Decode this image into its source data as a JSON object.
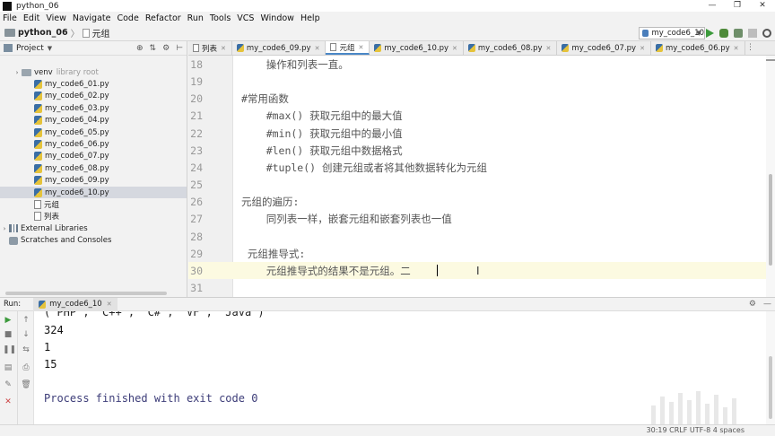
{
  "window": {
    "title": "python_06",
    "controls": [
      "—",
      "❐",
      "✕"
    ]
  },
  "menu": [
    "File",
    "Edit",
    "View",
    "Navigate",
    "Code",
    "Refactor",
    "Run",
    "Tools",
    "VCS",
    "Window",
    "Help"
  ],
  "nav": {
    "project": "python_06",
    "separator": "〉",
    "crumb": "元组",
    "run_config": "my_code6_10"
  },
  "project_panel": {
    "title": "Project",
    "tree": [
      {
        "kind": "folder",
        "label": "venv",
        "muted": "library root",
        "indent": 1,
        "arrow": "›"
      },
      {
        "kind": "py",
        "label": "my_code6_01.py",
        "indent": 2
      },
      {
        "kind": "py",
        "label": "my_code6_02.py",
        "indent": 2
      },
      {
        "kind": "py",
        "label": "my_code6_03.py",
        "indent": 2
      },
      {
        "kind": "py",
        "label": "my_code6_04.py",
        "indent": 2
      },
      {
        "kind": "py",
        "label": "my_code6_05.py",
        "indent": 2
      },
      {
        "kind": "py",
        "label": "my_code6_06.py",
        "indent": 2
      },
      {
        "kind": "py",
        "label": "my_code6_07.py",
        "indent": 2
      },
      {
        "kind": "py",
        "label": "my_code6_08.py",
        "indent": 2
      },
      {
        "kind": "py",
        "label": "my_code6_09.py",
        "indent": 2
      },
      {
        "kind": "py",
        "label": "my_code6_10.py",
        "indent": 2,
        "selected": true
      },
      {
        "kind": "txt",
        "label": "元组",
        "indent": 2
      },
      {
        "kind": "txt",
        "label": "列表",
        "indent": 2
      },
      {
        "kind": "lib",
        "label": "External Libraries",
        "indent": 0,
        "arrow": "›"
      },
      {
        "kind": "scratch",
        "label": "Scratches and Consoles",
        "indent": 0
      }
    ]
  },
  "tabs": [
    {
      "label": "列表",
      "kind": "txt"
    },
    {
      "label": "my_code6_09.py",
      "kind": "py"
    },
    {
      "label": "元组",
      "kind": "txt",
      "active": true
    },
    {
      "label": "my_code6_10.py",
      "kind": "py"
    },
    {
      "label": "my_code6_08.py",
      "kind": "py"
    },
    {
      "label": "my_code6_07.py",
      "kind": "py"
    },
    {
      "label": "my_code6_06.py",
      "kind": "py"
    }
  ],
  "editor": {
    "lines": [
      {
        "n": "18",
        "text": "    操作和列表一直。"
      },
      {
        "n": "19",
        "text": ""
      },
      {
        "n": "20",
        "text": "#常用函数"
      },
      {
        "n": "21",
        "text": "    #max() 获取元组中的最大值"
      },
      {
        "n": "22",
        "text": "    #min() 获取元组中的最小值"
      },
      {
        "n": "23",
        "text": "    #len() 获取元组中数据格式"
      },
      {
        "n": "24",
        "text": "    #tuple() 创建元组或者将其他数据转化为元组"
      },
      {
        "n": "25",
        "text": ""
      },
      {
        "n": "26",
        "text": "元组的遍历:"
      },
      {
        "n": "27",
        "text": "    同列表一样，嵌套元组和嵌套列表也一值"
      },
      {
        "n": "28",
        "text": ""
      },
      {
        "n": "29",
        "text": " 元组推导式:"
      },
      {
        "n": "30",
        "text": "    元组推导式的结果不是元组。二",
        "current": true
      },
      {
        "n": "31",
        "text": ""
      }
    ]
  },
  "run_panel": {
    "label": "Run:",
    "tab": "my_code6_10",
    "output": [
      "('PHP', 'C++', 'C#', 'VF', 'Java')",
      "324",
      "1",
      "15",
      "",
      "Process finished with exit code 0"
    ]
  },
  "status": {
    "text": "30:19  CRLF  UTF-8  4 spaces"
  }
}
